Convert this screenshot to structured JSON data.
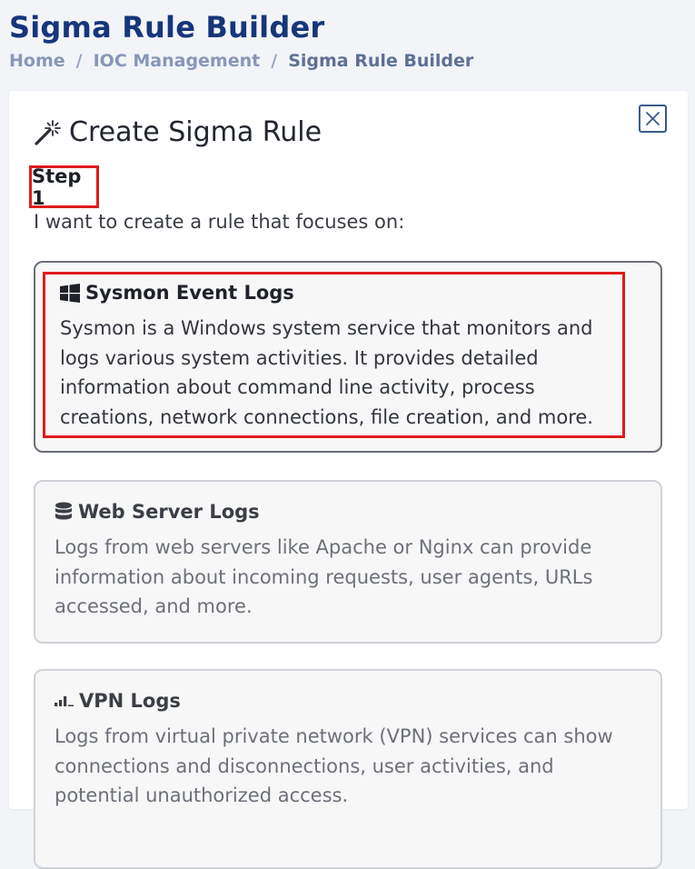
{
  "header": {
    "title": "Sigma Rule Builder",
    "breadcrumb": [
      {
        "label": "Home"
      },
      {
        "label": "IOC Management"
      },
      {
        "label": "Sigma Rule Builder"
      }
    ],
    "separator": "/"
  },
  "card": {
    "title": "Create Sigma Rule",
    "title_icon": "magic-wand-icon",
    "close_icon": "close-icon",
    "step_label": "Step 1",
    "step_description": "I want to create a rule that focuses on:"
  },
  "options": [
    {
      "icon": "windows-icon",
      "title": "Sysmon Event Logs",
      "description": "Sysmon is a Windows system service that monitors and logs various system activities. It provides detailed information about command line activity, process creations, network connections, file creation, and more.",
      "selected": true
    },
    {
      "icon": "database-icon",
      "title": "Web Server Logs",
      "description": "Logs from web servers like Apache or Nginx can provide information about incoming requests, user agents, URLs accessed, and more.",
      "selected": false
    },
    {
      "icon": "signal-bars-icon",
      "title": "VPN Logs",
      "description": "Logs from virtual private network (VPN) services can show connections and disconnections, user activities, and potential unauthorized access.",
      "selected": false
    }
  ],
  "colors": {
    "title": "#16367a",
    "highlight": "#e01b1b",
    "close_border": "#3a5a8a"
  }
}
